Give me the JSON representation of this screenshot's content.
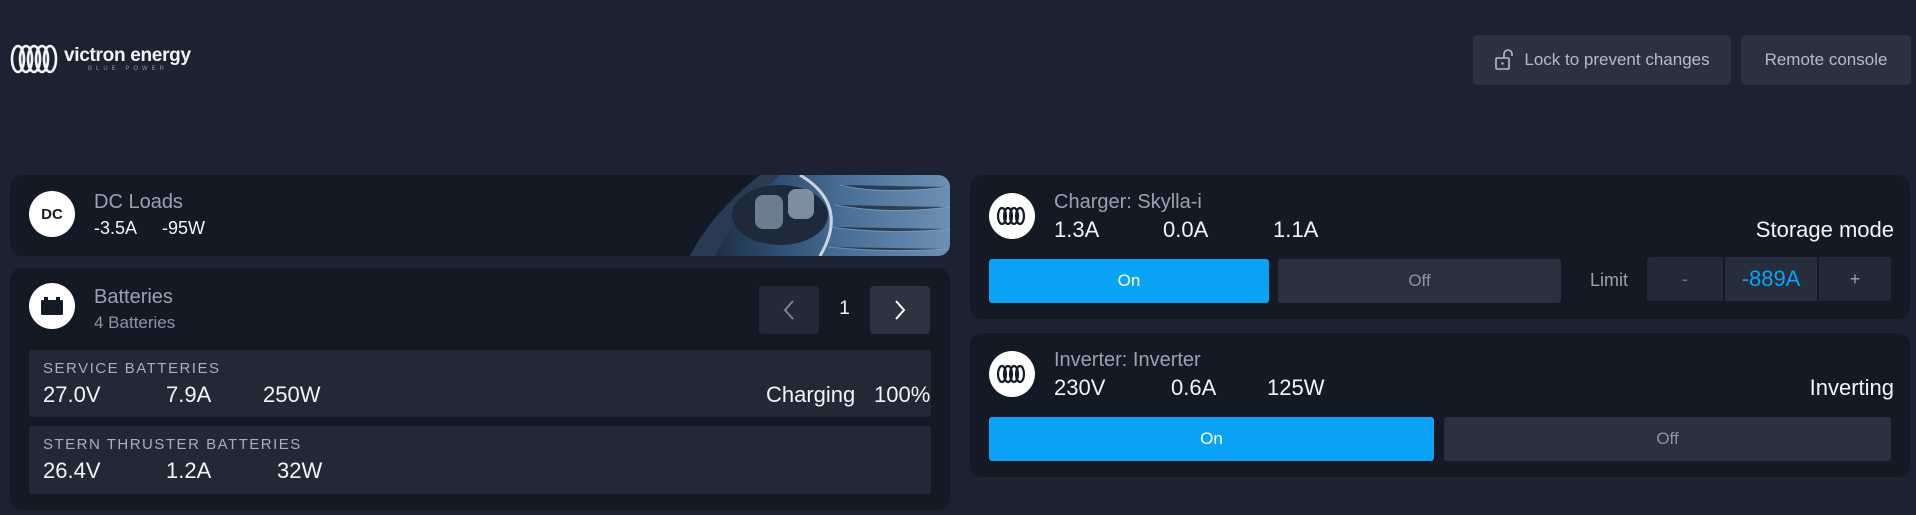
{
  "header": {
    "brand_name": "victron energy",
    "brand_tagline": "BLUE POWER",
    "lock_label": "Lock to prevent changes",
    "remote_label": "Remote console"
  },
  "dc_loads": {
    "icon_text": "DC",
    "title": "DC Loads",
    "current": "-3.5A",
    "power": "-95W"
  },
  "batteries": {
    "title": "Batteries",
    "subtitle": "4 Batteries",
    "page": "1",
    "rows": [
      {
        "name": "SERVICE BATTERIES",
        "voltage": "27.0V",
        "current": "7.9A",
        "power": "250W",
        "state": "Charging",
        "soc": "100%"
      },
      {
        "name": "STERN THRUSTER BATTERIES",
        "voltage": "26.4V",
        "current": "1.2A",
        "power": "32W"
      }
    ]
  },
  "charger": {
    "title": "Charger: Skylla-i",
    "values": [
      "1.3A",
      "0.0A",
      "1.1A"
    ],
    "mode": "Storage mode",
    "on_label": "On",
    "off_label": "Off",
    "limit_label": "Limit",
    "limit_minus": "-",
    "limit_value": "-889A",
    "limit_plus": "+"
  },
  "inverter": {
    "title": "Inverter: Inverter",
    "values": [
      "230V",
      "0.6A",
      "125W"
    ],
    "mode": "Inverting",
    "on_label": "On",
    "off_label": "Off"
  },
  "colors": {
    "background": "#1c2231",
    "panel": "#141a25",
    "accent": "#0aa3f5"
  },
  "icons": [
    "victron-logo-icon",
    "lock-icon",
    "battery-icon",
    "victron-device-icon",
    "chevron-left-icon",
    "chevron-right-icon"
  ]
}
